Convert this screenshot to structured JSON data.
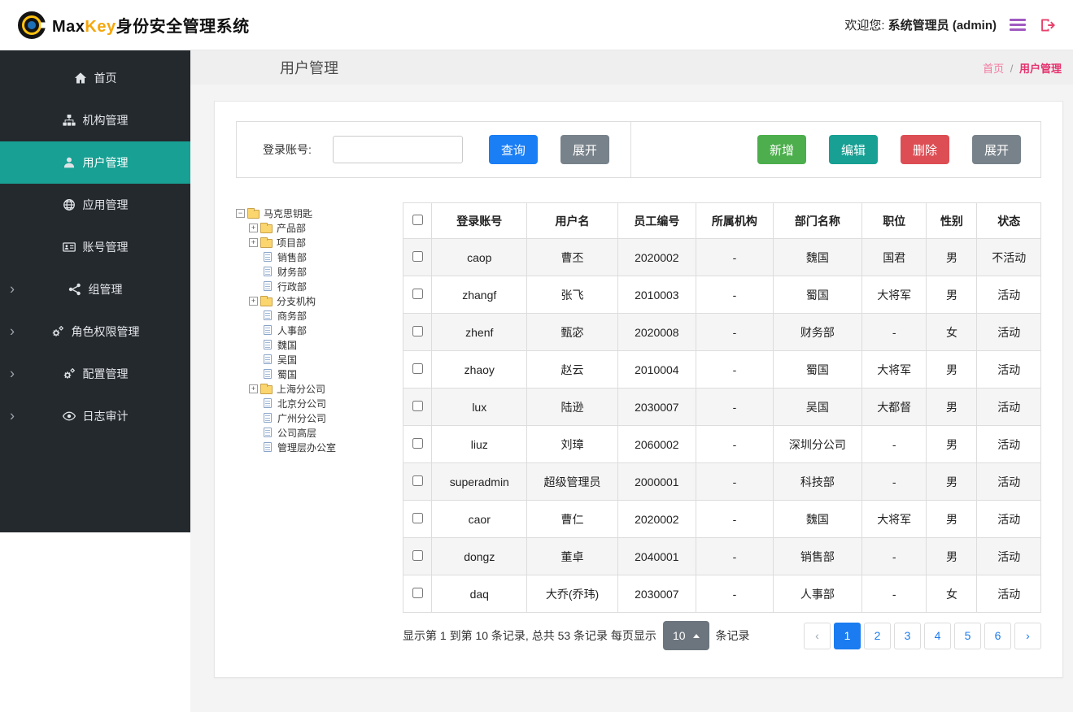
{
  "header": {
    "brand_max": "Max",
    "brand_key": "Key",
    "brand_suffix": "身份安全管理系统",
    "welcome_prefix": "欢迎您:",
    "welcome_user": "系统管理员 (admin)"
  },
  "sidebar": {
    "items": [
      {
        "id": "home",
        "label": "首页",
        "icon": "home-icon",
        "active": false,
        "expandable": false
      },
      {
        "id": "org",
        "label": "机构管理",
        "icon": "sitemap-icon",
        "active": false,
        "expandable": false
      },
      {
        "id": "user",
        "label": "用户管理",
        "icon": "user-icon",
        "active": true,
        "expandable": false
      },
      {
        "id": "app",
        "label": "应用管理",
        "icon": "globe-icon",
        "active": false,
        "expandable": false
      },
      {
        "id": "account",
        "label": "账号管理",
        "icon": "idcard-icon",
        "active": false,
        "expandable": false
      },
      {
        "id": "group",
        "label": "组管理",
        "icon": "share-icon",
        "active": false,
        "expandable": true
      },
      {
        "id": "role",
        "label": "角色权限管理",
        "icon": "gears-icon",
        "active": false,
        "expandable": true
      },
      {
        "id": "config",
        "label": "配置管理",
        "icon": "gears-icon",
        "active": false,
        "expandable": true
      },
      {
        "id": "audit",
        "label": "日志审计",
        "icon": "eye-icon",
        "active": false,
        "expandable": true
      }
    ]
  },
  "page": {
    "title": "用户管理",
    "breadcrumb_home": "首页",
    "breadcrumb_sep": "/",
    "breadcrumb_current": "用户管理"
  },
  "toolbar": {
    "search_label": "登录账号:",
    "search_value": "",
    "query_label": "查询",
    "expand_left_label": "展开",
    "add_label": "新增",
    "edit_label": "编辑",
    "delete_label": "删除",
    "expand_right_label": "展开"
  },
  "tree": {
    "root": {
      "label": "马克思钥匙",
      "kind": "folder",
      "expander": "minus"
    },
    "nodes": [
      {
        "label": "产品部",
        "kind": "folder",
        "expander": "plus"
      },
      {
        "label": "项目部",
        "kind": "folder",
        "expander": "plus"
      },
      {
        "label": "销售部",
        "kind": "file"
      },
      {
        "label": "财务部",
        "kind": "file"
      },
      {
        "label": "行政部",
        "kind": "file"
      },
      {
        "label": "分支机构",
        "kind": "folder",
        "expander": "plus"
      },
      {
        "label": "商务部",
        "kind": "file"
      },
      {
        "label": "人事部",
        "kind": "file"
      },
      {
        "label": "魏国",
        "kind": "file"
      },
      {
        "label": "吴国",
        "kind": "file"
      },
      {
        "label": "蜀国",
        "kind": "file"
      },
      {
        "label": "上海分公司",
        "kind": "folder",
        "expander": "plus"
      },
      {
        "label": "北京分公司",
        "kind": "file"
      },
      {
        "label": "广州分公司",
        "kind": "file"
      },
      {
        "label": "公司高层",
        "kind": "file"
      },
      {
        "label": "管理层办公室",
        "kind": "file"
      }
    ]
  },
  "table": {
    "columns": [
      "登录账号",
      "用户名",
      "员工编号",
      "所属机构",
      "部门名称",
      "职位",
      "性别",
      "状态"
    ],
    "rows": [
      [
        "caop",
        "曹丕",
        "2020002",
        "-",
        "魏国",
        "国君",
        "男",
        "不活动"
      ],
      [
        "zhangf",
        "张飞",
        "2010003",
        "-",
        "蜀国",
        "大将军",
        "男",
        "活动"
      ],
      [
        "zhenf",
        "甄宓",
        "2020008",
        "-",
        "财务部",
        "-",
        "女",
        "活动"
      ],
      [
        "zhaoy",
        "赵云",
        "2010004",
        "-",
        "蜀国",
        "大将军",
        "男",
        "活动"
      ],
      [
        "lux",
        "陆逊",
        "2030007",
        "-",
        "吴国",
        "大都督",
        "男",
        "活动"
      ],
      [
        "liuz",
        "刘璋",
        "2060002",
        "-",
        "深圳分公司",
        "-",
        "男",
        "活动"
      ],
      [
        "superadmin",
        "超级管理员",
        "2000001",
        "-",
        "科技部",
        "-",
        "男",
        "活动"
      ],
      [
        "caor",
        "曹仁",
        "2020002",
        "-",
        "魏国",
        "大将军",
        "男",
        "活动"
      ],
      [
        "dongz",
        "董卓",
        "2040001",
        "-",
        "销售部",
        "-",
        "男",
        "活动"
      ],
      [
        "daq",
        "大乔(乔玮)",
        "2030007",
        "-",
        "人事部",
        "-",
        "女",
        "活动"
      ]
    ]
  },
  "pagination": {
    "summary": "显示第 1 到第 10 条记录, 总共 53 条记录  每页显示",
    "page_size": "10",
    "unit": "条记录",
    "prev": "‹",
    "next": "›",
    "pages": [
      "1",
      "2",
      "3",
      "4",
      "5",
      "6"
    ],
    "active": "1"
  },
  "colors": {
    "accent_teal": "#17a093",
    "primary_blue": "#1a7ef5",
    "success_green": "#4cae4c",
    "danger_red": "#dc4e54",
    "neutral_gray": "#78828a",
    "breadcrumb_pink": "#e6326e"
  }
}
